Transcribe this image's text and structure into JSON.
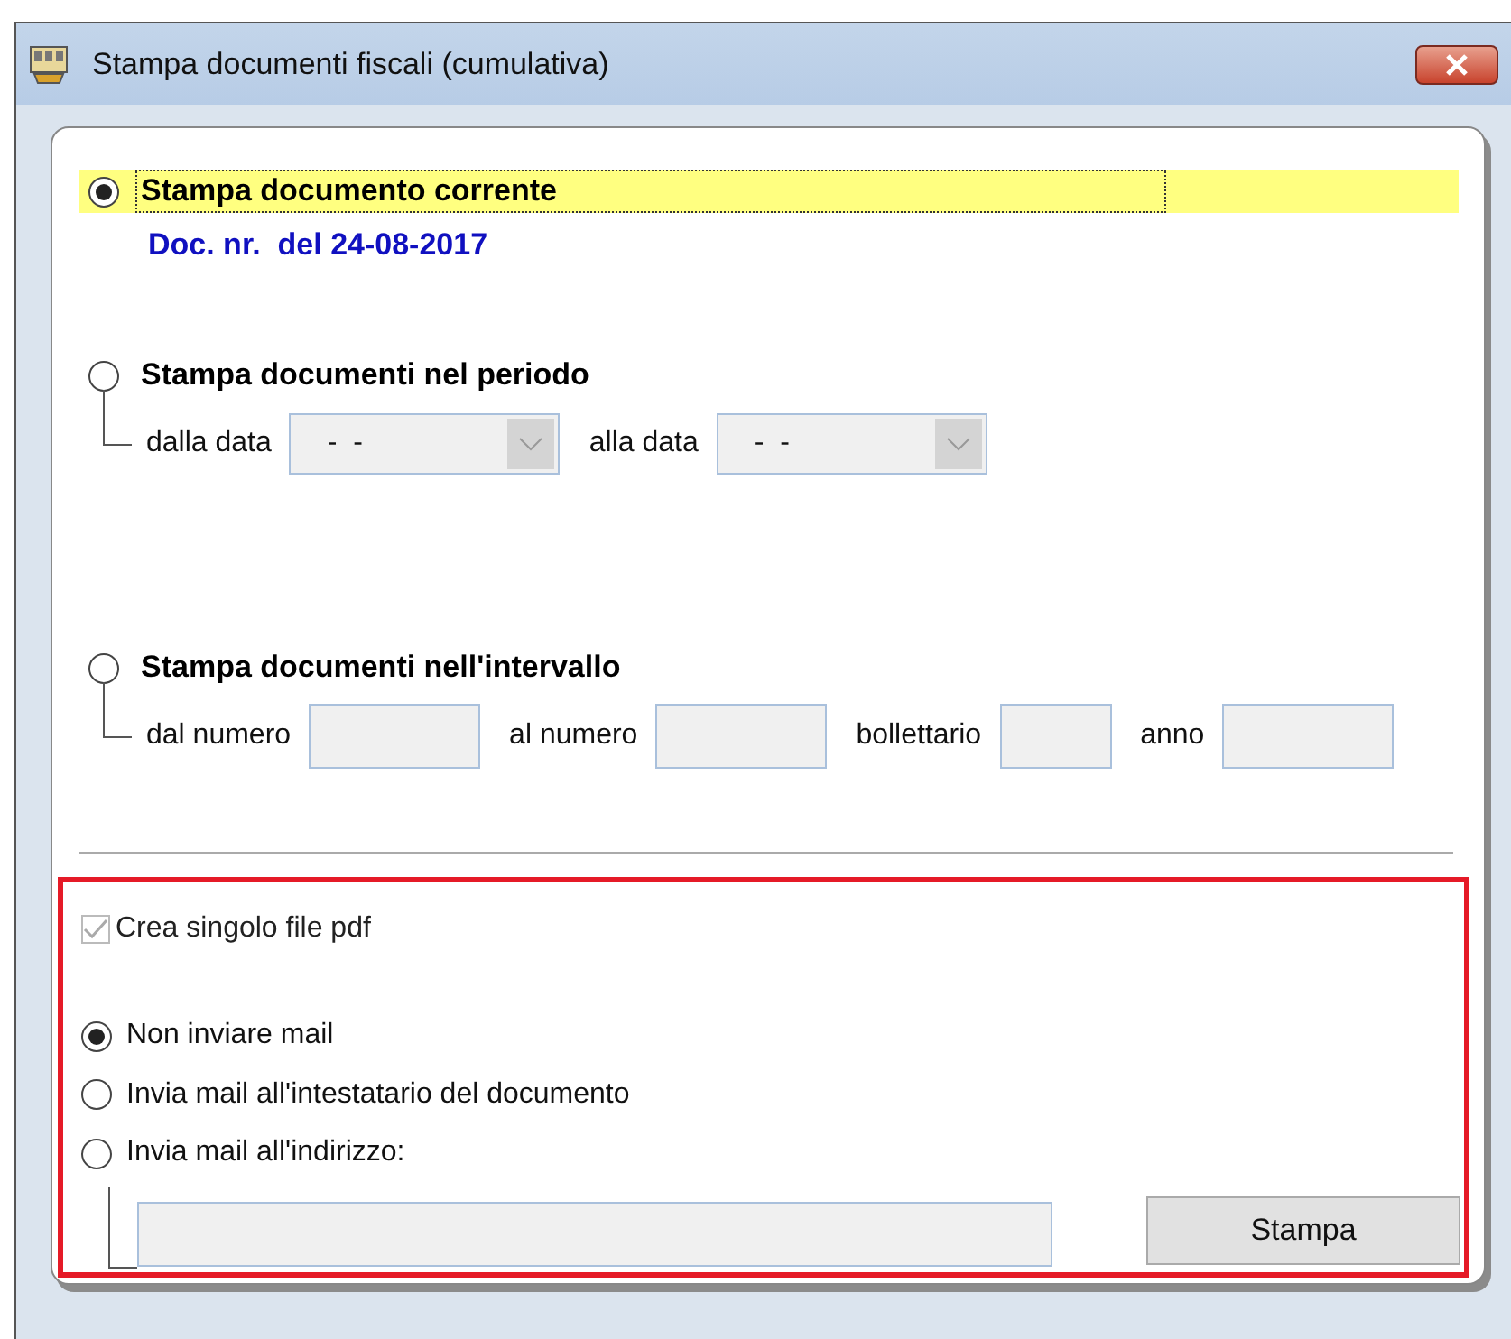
{
  "window": {
    "title": "Stampa documenti fiscali (cumulativa)"
  },
  "print_options": [
    {
      "label": "Stampa documento corrente",
      "selected": true,
      "highlighted": true,
      "detail": "Doc. nr.  del 24-08-2017"
    },
    {
      "label": "Stampa documenti nel periodo",
      "selected": false,
      "highlighted": false,
      "fields": [
        {
          "label": "dalla data",
          "kind": "combo",
          "value": "-  -"
        },
        {
          "label": "alla data",
          "kind": "combo",
          "value": "-  -"
        }
      ]
    },
    {
      "label": "Stampa documenti nell'intervallo",
      "selected": false,
      "highlighted": false,
      "fields": [
        {
          "label": "dal numero",
          "kind": "text"
        },
        {
          "label": "al numero",
          "kind": "text"
        },
        {
          "label": "bollettario",
          "kind": "short"
        },
        {
          "label": "anno",
          "kind": "text"
        }
      ]
    }
  ],
  "single_pdf": {
    "label": "Crea singolo file pdf",
    "checked": true,
    "disabled": true
  },
  "mail_options": [
    {
      "label": "Non inviare mail",
      "selected": true
    },
    {
      "label": "Invia mail all'intestatario del documento",
      "selected": false
    },
    {
      "label": "Invia mail all'indirizzo:",
      "selected": false
    }
  ],
  "print_button": "Stampa"
}
